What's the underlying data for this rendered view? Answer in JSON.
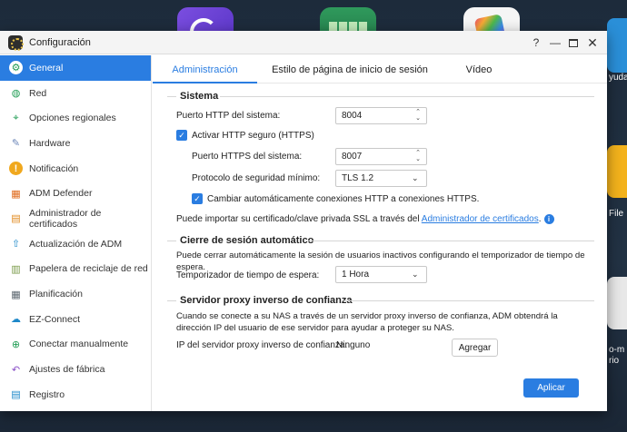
{
  "window": {
    "title": "Configuración"
  },
  "sidebar": {
    "items": [
      {
        "label": "General",
        "icon": "gear-icon",
        "color": "#1f9c53",
        "active": true
      },
      {
        "label": "Red",
        "icon": "globe-icon",
        "color": "#1f9c53"
      },
      {
        "label": "Opciones regionales",
        "icon": "location-icon",
        "color": "#1f9c53"
      },
      {
        "label": "Hardware",
        "icon": "wrench-icon",
        "color": "#6b86b8"
      },
      {
        "label": "Notificación",
        "icon": "alert-icon",
        "color": "#f0a81e"
      },
      {
        "label": "ADM Defender",
        "icon": "firewall-icon",
        "color": "#e06a1c"
      },
      {
        "label": "Administrador de certificados",
        "icon": "certificate-icon",
        "color": "#e0891c"
      },
      {
        "label": "Actualización de ADM",
        "icon": "update-icon",
        "color": "#1e88c9"
      },
      {
        "label": "Papelera de reciclaje de red",
        "icon": "trash-icon",
        "color": "#7a9a48"
      },
      {
        "label": "Planificación",
        "icon": "calendar-icon",
        "color": "#5c6770"
      },
      {
        "label": "EZ-Connect",
        "icon": "cloud-icon",
        "color": "#1e88c9"
      },
      {
        "label": "Conectar manualmente",
        "icon": "connect-icon",
        "color": "#1f9c53"
      },
      {
        "label": "Ajustes de fábrica",
        "icon": "undo-icon",
        "color": "#8a4fc7"
      },
      {
        "label": "Registro",
        "icon": "log-icon",
        "color": "#1e88c9"
      }
    ]
  },
  "tabs": [
    {
      "label": "Administración",
      "active": true
    },
    {
      "label": "Estilo de página de inicio de sesión"
    },
    {
      "label": "Vídeo"
    }
  ],
  "sistema": {
    "title": "Sistema",
    "http_port_label": "Puerto HTTP del sistema:",
    "http_port_value": "8004",
    "https_checkbox_label": "Activar HTTP seguro (HTTPS)",
    "https_port_label": "Puerto HTTPS del sistema:",
    "https_port_value": "8007",
    "protocol_label": "Protocolo de seguridad mínimo:",
    "protocol_value": "TLS 1.2",
    "redirect_checkbox_label": "Cambiar automáticamente conexiones HTTP a conexiones HTTPS.",
    "import_text": "Puede importar su certificado/clave privada SSL a través del",
    "import_link": "Administrador de certificados",
    "import_suffix": "."
  },
  "cierre": {
    "title": "Cierre de sesión automático",
    "description": "Puede cerrar automáticamente la sesión de usuarios inactivos configurando el temporizador de tiempo de espera.",
    "timer_label": "Temporizador de tiempo de espera:",
    "timer_value": "1 Hora"
  },
  "proxy": {
    "title": "Servidor proxy inverso de confianza",
    "description": "Cuando se conecte a su NAS a través de un servidor proxy inverso de confianza, ADM obtendrá la dirección IP del usuario de ese servidor para ayudar a proteger su NAS.",
    "ip_label": "IP del servidor proxy inverso de confianza:",
    "ip_value": "Ninguno",
    "add_button": "Agregar"
  },
  "footer": {
    "apply_button": "Aplicar"
  },
  "desktop": {
    "labels": [
      "yuda",
      "File",
      "o-m",
      "rio"
    ]
  },
  "colors": {
    "accent": "#2a7de1"
  }
}
